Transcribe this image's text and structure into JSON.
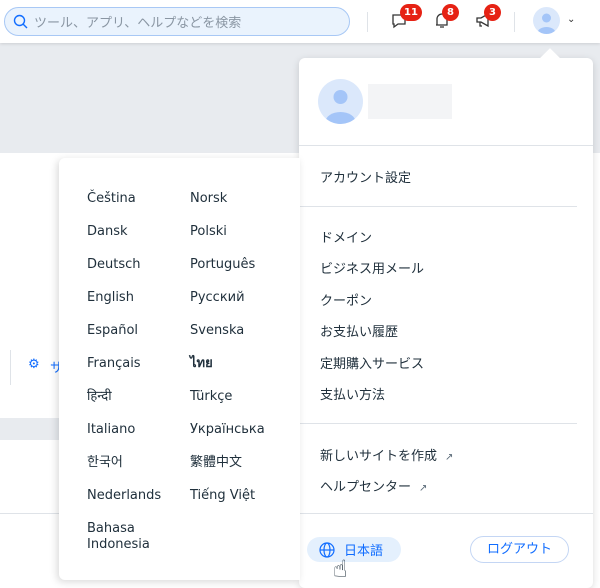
{
  "header": {
    "search_placeholder": "ツール、アプリ、ヘルプなどを検索",
    "badges": {
      "messages": "11",
      "notifications": "8",
      "announcements": "3"
    }
  },
  "background": {
    "settings_label": "サ"
  },
  "account_menu": {
    "account_settings": "アカウント設定",
    "items": [
      "ドメイン",
      "ビジネス用メール",
      "クーポン",
      "お支払い履歴",
      "定期購入サービス",
      "支払い方法"
    ],
    "links": [
      "新しいサイトを作成",
      "ヘルプセンター"
    ],
    "language_button": "日本語",
    "logout": "ログアウト"
  },
  "languages": {
    "col1": [
      "Čeština",
      "Dansk",
      "Deutsch",
      "English",
      "Español",
      "Français",
      "हिन्दी",
      "Italiano",
      "한국어",
      "Nederlands",
      "Bahasa Indonesia"
    ],
    "col2": [
      "Norsk",
      "Polski",
      "Português",
      "Русский",
      "Svenska",
      "ไทย",
      "Türkçe",
      "Українська",
      "繁體中文",
      "Tiếng Việt"
    ]
  },
  "colors": {
    "accent": "#116dff",
    "badge": "#e62214"
  }
}
